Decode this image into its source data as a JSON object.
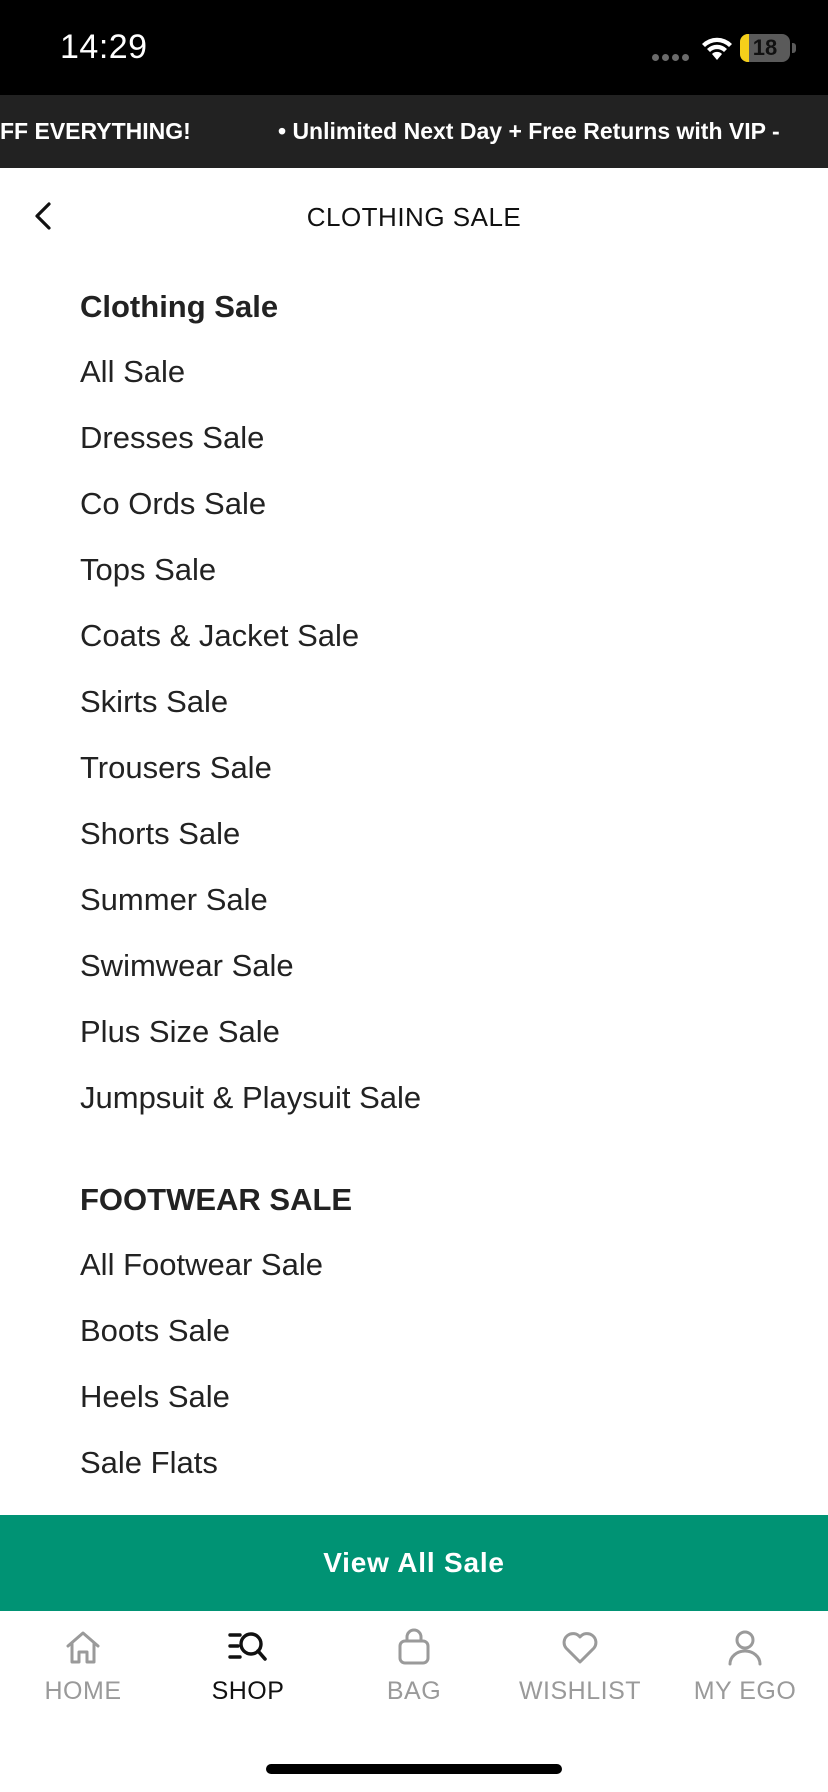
{
  "status_bar": {
    "time": "14:29",
    "battery_level": "18",
    "battery_fraction": 0.18
  },
  "promo": {
    "left_text": "FF EVERYTHING!",
    "right_text": "• Unlimited Next Day + Free Returns with VIP -"
  },
  "header": {
    "title": "CLOTHING SALE",
    "back_icon": "chevron-left-icon"
  },
  "clothing": {
    "heading": "Clothing Sale",
    "items": [
      {
        "label": "All Sale"
      },
      {
        "label": "Dresses Sale"
      },
      {
        "label": "Co Ords Sale"
      },
      {
        "label": "Tops Sale"
      },
      {
        "label": "Coats & Jacket Sale"
      },
      {
        "label": "Skirts Sale"
      },
      {
        "label": "Trousers Sale"
      },
      {
        "label": "Shorts Sale"
      },
      {
        "label": "Summer Sale"
      },
      {
        "label": "Swimwear Sale"
      },
      {
        "label": "Plus Size Sale"
      },
      {
        "label": "Jumpsuit & Playsuit Sale"
      }
    ]
  },
  "footwear": {
    "heading": "FOOTWEAR SALE",
    "items": [
      {
        "label": "All Footwear Sale"
      },
      {
        "label": "Boots Sale"
      },
      {
        "label": "Heels Sale"
      },
      {
        "label": "Sale Flats"
      }
    ]
  },
  "cta": {
    "label": "View All Sale",
    "color": "#009374"
  },
  "tabbar": {
    "tabs": [
      {
        "label": "HOME",
        "icon": "home-icon",
        "active": false
      },
      {
        "label": "SHOP",
        "icon": "search-menu-icon",
        "active": true
      },
      {
        "label": "BAG",
        "icon": "bag-icon",
        "active": false
      },
      {
        "label": "WISHLIST",
        "icon": "heart-icon",
        "active": false
      },
      {
        "label": "MY EGO",
        "icon": "person-icon",
        "active": false
      }
    ]
  }
}
